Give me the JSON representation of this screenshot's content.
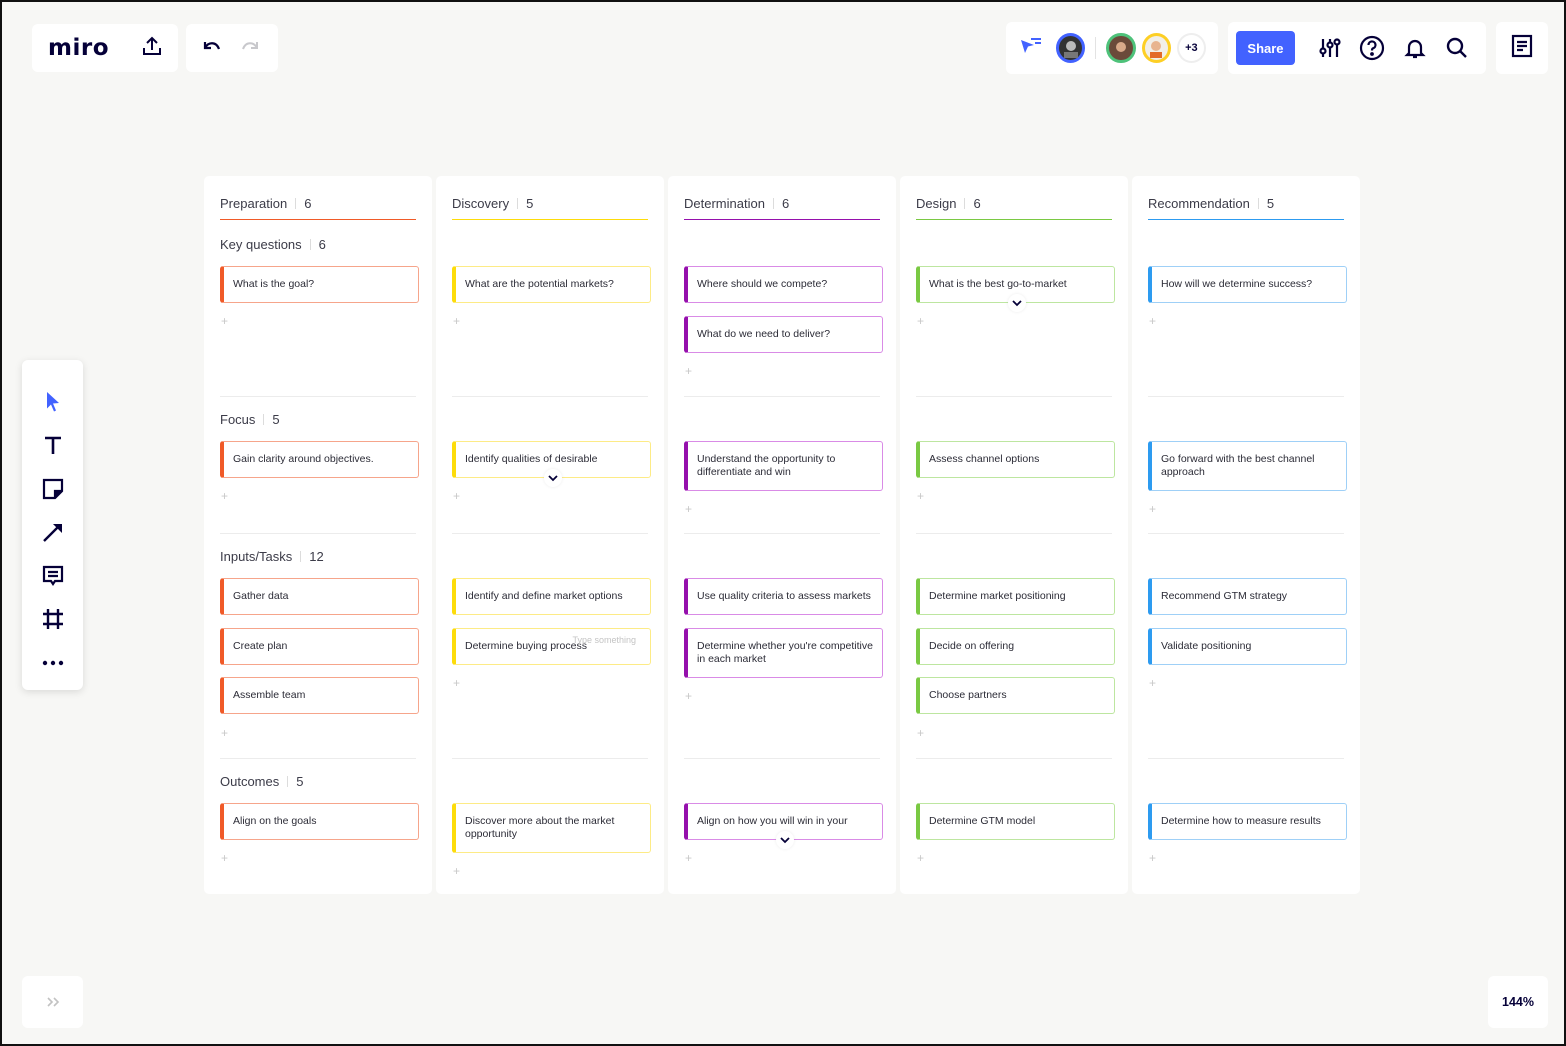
{
  "app": {
    "logo": "miro"
  },
  "collaborators": {
    "more_count": "+3"
  },
  "toolbar_top": {
    "share_label": "Share"
  },
  "zoom_level": "144%",
  "colors": {
    "accent": "#4262ff",
    "preparation": "#f05a28",
    "discovery": "#fddc0a",
    "determination": "#9510ac",
    "design": "#7ac943",
    "recommendation": "#2d9bf0"
  },
  "columns": [
    {
      "title": "Preparation",
      "count": "6"
    },
    {
      "title": "Discovery",
      "count": "5"
    },
    {
      "title": "Determination",
      "count": "6"
    },
    {
      "title": "Design",
      "count": "6"
    },
    {
      "title": "Recommendation",
      "count": "5"
    }
  ],
  "rows": [
    {
      "title": "Key questions",
      "count": "6"
    },
    {
      "title": "Focus",
      "count": "5"
    },
    {
      "title": "Inputs/Tasks",
      "count": "12"
    },
    {
      "title": "Outcomes",
      "count": "5"
    }
  ],
  "cards": {
    "prep_key_1": "What is the goal?",
    "disc_key_1": "What are the potential markets?",
    "det_key_1": "Where should we compete?",
    "det_key_2": "What do we need to deliver?",
    "des_key_1": "What is the best go-to-market",
    "rec_key_1": "How will we determine success?",
    "prep_focus_1": "Gain clarity around objectives.",
    "disc_focus_1": "Identify qualities of desirable",
    "det_focus_1": "Understand the opportunity to differentiate and win",
    "des_focus_1": "Assess channel options",
    "rec_focus_1": "Go forward with the best channel approach",
    "prep_task_1": "Gather data",
    "prep_task_2": "Create plan",
    "prep_task_3": "Assemble team",
    "disc_task_1": "Identify and define market options",
    "disc_task_2": "Determine buying process",
    "disc_task_2_hint": "Type something",
    "det_task_1": "Use quality criteria to assess markets",
    "det_task_2": "Determine whether you're competitive in each market",
    "des_task_1": "Determine market positioning",
    "des_task_2": "Decide on offering",
    "des_task_3": "Choose partners",
    "rec_task_1": "Recommend GTM strategy",
    "rec_task_2": "Validate positioning",
    "prep_out_1": "Align on the goals",
    "disc_out_1": "Discover more about the market opportunity",
    "det_out_1": "Align on how you will win in your",
    "des_out_1": "Determine GTM model",
    "rec_out_1": "Determine how to measure results"
  },
  "add_symbol": "+"
}
